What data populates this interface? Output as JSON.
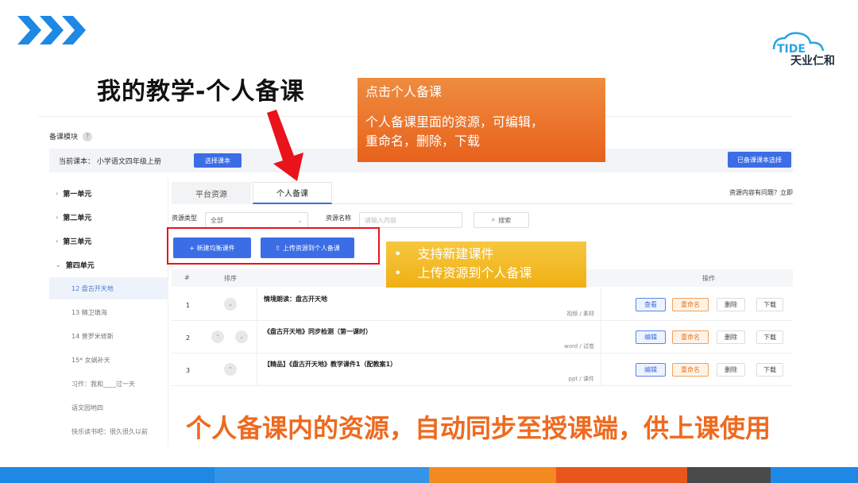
{
  "slide": {
    "title": "我的教学-个人备课",
    "logo_text": "天业仁和",
    "logo_letters": "TIDE",
    "bottom_caption": "个人备课内的资源，自动同步至授课端，供上课使用",
    "colors": {
      "accent_blue": "#1e88e5",
      "orange": "#ee6a1f",
      "callout_orange": "#ea7230",
      "callout_yellow": "#f3bb26",
      "highlight_red": "#e8131b"
    }
  },
  "callouts": {
    "orange": [
      "点击个人备课",
      "个人备课里面的资源，可编辑，",
      "重命名，删除，下载"
    ],
    "yellow": [
      "支持新建课件",
      "上传资源到个人备课"
    ],
    "bullet": "•"
  },
  "app": {
    "module_label": "备课模块",
    "help_icon": "?",
    "current_course_label": "当前课本：  小学语文四年级上册",
    "select_course_button": "选择课本",
    "selected_course_button": "已备课课本选择",
    "sidebar": [
      {
        "label": "第一单元",
        "kind": "unit",
        "arrow": "›"
      },
      {
        "label": "第二单元",
        "kind": "unit",
        "arrow": "›"
      },
      {
        "label": "第三单元",
        "kind": "unit",
        "arrow": "›"
      },
      {
        "label": "第四单元",
        "kind": "unit",
        "arrow": "⌄"
      },
      {
        "label": "12 盘古开天地",
        "kind": "sub",
        "active": true
      },
      {
        "label": "13 精卫填海",
        "kind": "sub"
      },
      {
        "label": "14 普罗米修斯",
        "kind": "sub"
      },
      {
        "label": "15* 女娲补天",
        "kind": "sub"
      },
      {
        "label": "习作：我和____过一天",
        "kind": "sub"
      },
      {
        "label": "语文园地四",
        "kind": "sub"
      },
      {
        "label": "快乐读书吧：很久很久以前",
        "kind": "sub"
      }
    ],
    "tabs": [
      {
        "label": "平台资源",
        "active": false
      },
      {
        "label": "个人备课",
        "active": true
      }
    ],
    "notice": "资源内容有问题？立即",
    "filters": {
      "type_label": "资源类型",
      "type_value": "全部",
      "name_label": "资源名称",
      "name_placeholder": "请输入内容",
      "search_button": "搜索"
    },
    "actions": {
      "new_courseware": "+ 新建均衡课件",
      "upload": "上传资源到个人备课"
    },
    "table": {
      "headers": {
        "num": "#",
        "sort": "排序",
        "ops": "操作"
      },
      "rows": [
        {
          "num": "1",
          "title": "情境朗读：盘古开天地",
          "type": "视频 / 素材",
          "first_action": "查看",
          "sort_buttons": [
            "⌄"
          ]
        },
        {
          "num": "2",
          "title": "《盘古开天地》同步检测（第一课时）",
          "type": "word / 试卷",
          "first_action": "编辑",
          "sort_buttons": [
            "⌃",
            "⌄"
          ]
        },
        {
          "num": "3",
          "title": "【精品】《盘古开天地》教学课件1（配教案1）",
          "type": "ppt / 课件",
          "first_action": "编辑",
          "sort_buttons": [
            "⌃"
          ]
        }
      ],
      "rename": "重命名",
      "delete": "删除",
      "download": "下载"
    }
  }
}
